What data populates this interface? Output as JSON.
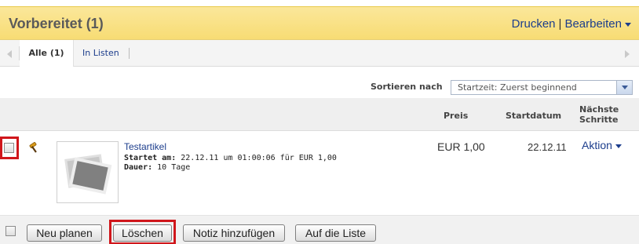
{
  "header": {
    "title": "Vorbereitet (1)",
    "print_label": "Drucken",
    "separator": "|",
    "edit_label": "Bearbeiten"
  },
  "tabs": [
    {
      "label": "Alle (1)",
      "active": true
    },
    {
      "label": "In Listen",
      "active": false
    }
  ],
  "sort": {
    "label": "Sortieren nach",
    "selected": "Startzeit: Zuerst beginnend"
  },
  "columns": {
    "price": "Preis",
    "start_date": "Startdatum",
    "next_steps": "Nächste Schritte"
  },
  "item": {
    "title": "Testartikel",
    "start_label": "Startet am:",
    "start_value": "22.12.11 um 01:00:06 für EUR 1,00",
    "duration_label": "Dauer:",
    "duration_value": "10 Tage",
    "price": "EUR 1,00",
    "start_date": "22.12.11",
    "action_label": "Aktion"
  },
  "footer": {
    "buttons": [
      "Neu planen",
      "Löschen",
      "Notiz hinzufügen",
      "Auf die Liste"
    ]
  },
  "colors": {
    "header_bg": "#f7dc74",
    "link": "#1c3d8c",
    "highlight": "#d0161b"
  },
  "icons": [
    "hammer-icon",
    "image-placeholder-icon",
    "chevron-left-icon",
    "chevron-right-icon",
    "dropdown-arrow-icon"
  ]
}
